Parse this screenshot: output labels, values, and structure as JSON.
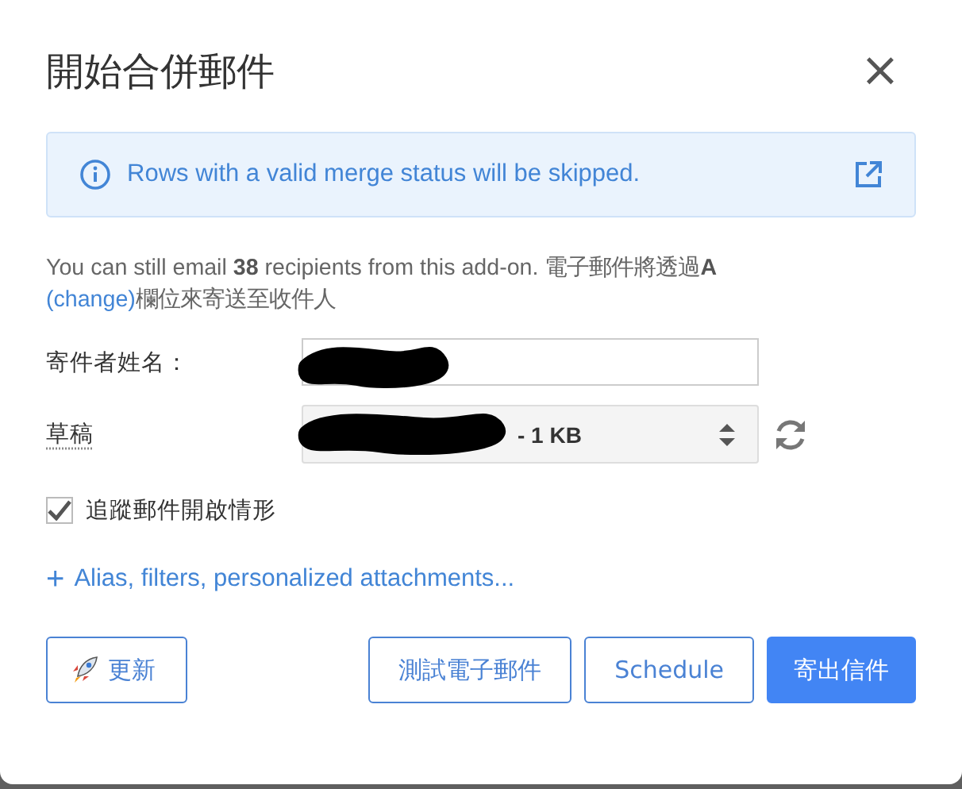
{
  "dialog": {
    "title": "開始合併郵件",
    "close": "×"
  },
  "notice": {
    "text": "Rows with a valid merge status will be skipped."
  },
  "quota": {
    "text": "You can still email **38** recipients from this add-on. 電子郵件將透過**A**",
    "link": "(change)",
    "text_after": "欄位來寄送至收件人"
  },
  "fields": [
    {
      "kind": "input",
      "label": "寄件者姓名："
    },
    {
      "kind": "select",
      "label": "草稿",
      "value": "- 1 KB"
    }
  ],
  "track_opens": {
    "label": "追蹤郵件開啟情形",
    "checked": true
  },
  "more_options": {
    "icon": "+",
    "label": "Alias, filters, personalized attachments..."
  },
  "buttons": [
    {
      "label": "更新",
      "kind": "update"
    },
    {
      "label": "測試電子郵件",
      "kind": "outline"
    },
    {
      "label": "Schedule",
      "kind": "outline"
    },
    {
      "label": "寄出信件",
      "kind": "primary"
    }
  ]
}
